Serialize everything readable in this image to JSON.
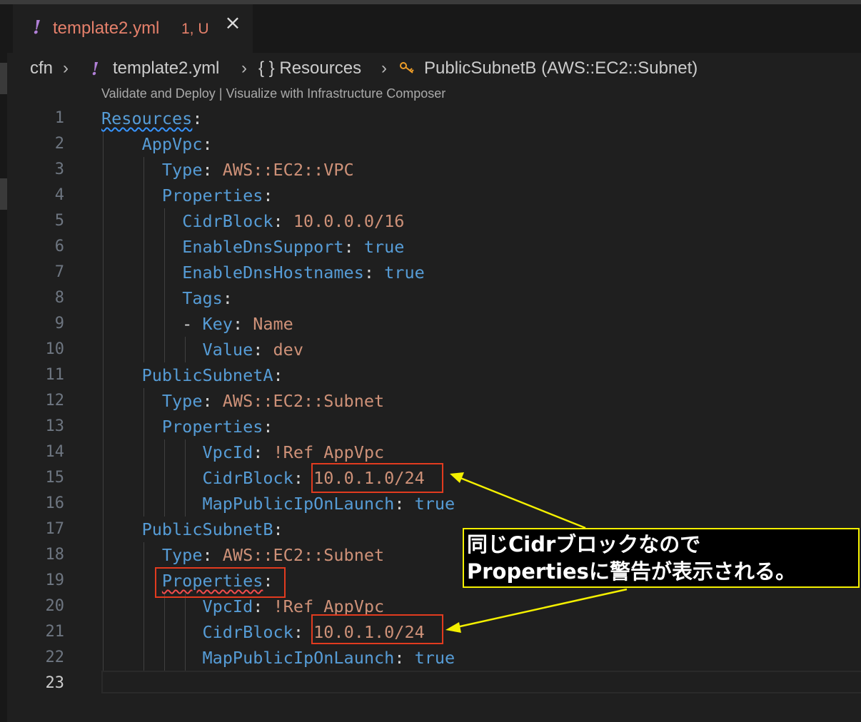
{
  "tab": {
    "icon": "yaml-icon",
    "filename": "template2.yml",
    "badge": "1, U",
    "close_icon": "close-icon"
  },
  "breadcrumb": {
    "root": "cfn",
    "file": "template2.yml",
    "section": "{ } Resources",
    "resource_icon": "symbol-key-icon",
    "resource": "PublicSubnetB (AWS::EC2::Subnet)"
  },
  "codelens": "Validate and Deploy | Visualize with Infrastructure Composer",
  "lines": [
    {
      "n": "1",
      "tokens": [
        [
          "k",
          "Resources"
        ],
        [
          "p",
          ":"
        ]
      ]
    },
    {
      "n": "2",
      "tokens": [
        [
          "p",
          "    "
        ],
        [
          "k",
          "AppVpc"
        ],
        [
          "p",
          ":"
        ]
      ]
    },
    {
      "n": "3",
      "tokens": [
        [
          "p",
          "      "
        ],
        [
          "k",
          "Type"
        ],
        [
          "p",
          ": "
        ],
        [
          "v",
          "AWS::EC2::VPC"
        ]
      ]
    },
    {
      "n": "4",
      "tokens": [
        [
          "p",
          "      "
        ],
        [
          "k",
          "Properties"
        ],
        [
          "p",
          ":"
        ]
      ]
    },
    {
      "n": "5",
      "tokens": [
        [
          "p",
          "        "
        ],
        [
          "k",
          "CidrBlock"
        ],
        [
          "p",
          ": "
        ],
        [
          "v",
          "10.0.0.0/16"
        ]
      ]
    },
    {
      "n": "6",
      "tokens": [
        [
          "p",
          "        "
        ],
        [
          "k",
          "EnableDnsSupport"
        ],
        [
          "p",
          ": "
        ],
        [
          "b",
          "true"
        ]
      ]
    },
    {
      "n": "7",
      "tokens": [
        [
          "p",
          "        "
        ],
        [
          "k",
          "EnableDnsHostnames"
        ],
        [
          "p",
          ": "
        ],
        [
          "b",
          "true"
        ]
      ]
    },
    {
      "n": "8",
      "tokens": [
        [
          "p",
          "        "
        ],
        [
          "k",
          "Tags"
        ],
        [
          "p",
          ":"
        ]
      ]
    },
    {
      "n": "9",
      "tokens": [
        [
          "p",
          "        - "
        ],
        [
          "k",
          "Key"
        ],
        [
          "p",
          ": "
        ],
        [
          "v",
          "Name"
        ]
      ]
    },
    {
      "n": "10",
      "tokens": [
        [
          "p",
          "          "
        ],
        [
          "k",
          "Value"
        ],
        [
          "p",
          ": "
        ],
        [
          "v",
          "dev"
        ]
      ]
    },
    {
      "n": "11",
      "tokens": [
        [
          "p",
          "    "
        ],
        [
          "k",
          "PublicSubnetA"
        ],
        [
          "p",
          ":"
        ]
      ]
    },
    {
      "n": "12",
      "tokens": [
        [
          "p",
          "      "
        ],
        [
          "k",
          "Type"
        ],
        [
          "p",
          ": "
        ],
        [
          "v",
          "AWS::EC2::Subnet"
        ]
      ]
    },
    {
      "n": "13",
      "tokens": [
        [
          "p",
          "      "
        ],
        [
          "k",
          "Properties"
        ],
        [
          "p",
          ":"
        ]
      ]
    },
    {
      "n": "14",
      "tokens": [
        [
          "p",
          "          "
        ],
        [
          "k",
          "VpcId"
        ],
        [
          "p",
          ": "
        ],
        [
          "v",
          "!Ref AppVpc"
        ]
      ]
    },
    {
      "n": "15",
      "tokens": [
        [
          "p",
          "          "
        ],
        [
          "k",
          "CidrBlock"
        ],
        [
          "p",
          ": "
        ],
        [
          "v",
          "10.0.1.0/24"
        ]
      ]
    },
    {
      "n": "16",
      "tokens": [
        [
          "p",
          "          "
        ],
        [
          "k",
          "MapPublicIpOnLaunch"
        ],
        [
          "p",
          ": "
        ],
        [
          "b",
          "true"
        ]
      ]
    },
    {
      "n": "17",
      "tokens": [
        [
          "p",
          "    "
        ],
        [
          "k",
          "PublicSubnetB"
        ],
        [
          "p",
          ":"
        ]
      ]
    },
    {
      "n": "18",
      "tokens": [
        [
          "p",
          "      "
        ],
        [
          "k",
          "Type"
        ],
        [
          "p",
          ": "
        ],
        [
          "v",
          "AWS::EC2::Subnet"
        ]
      ]
    },
    {
      "n": "19",
      "tokens": [
        [
          "p",
          "      "
        ],
        [
          "k",
          "Properties"
        ],
        [
          "p",
          ":"
        ]
      ]
    },
    {
      "n": "20",
      "tokens": [
        [
          "p",
          "          "
        ],
        [
          "k",
          "VpcId"
        ],
        [
          "p",
          ": "
        ],
        [
          "v",
          "!Ref AppVpc"
        ]
      ]
    },
    {
      "n": "21",
      "tokens": [
        [
          "p",
          "          "
        ],
        [
          "k",
          "CidrBlock"
        ],
        [
          "p",
          ": "
        ],
        [
          "v",
          "10.0.1.0/24"
        ]
      ]
    },
    {
      "n": "22",
      "tokens": [
        [
          "p",
          "          "
        ],
        [
          "k",
          "MapPublicIpOnLaunch"
        ],
        [
          "p",
          ": "
        ],
        [
          "b",
          "true"
        ]
      ]
    },
    {
      "n": "23",
      "tokens": []
    }
  ],
  "active_line": "23",
  "diagnostics": {
    "resources_squiggle_color": "#3794ff",
    "properties_squiggle_color": "#f14c4c"
  },
  "annotation": {
    "line1": "同じCidrブロックなので",
    "line2": "Propertiesに警告が表示される。",
    "box_color": "#e23b1f",
    "callout_border": "#f4f000",
    "arrow_color": "#f4f000"
  },
  "colors": {
    "key": "#569cd6",
    "string": "#ce9178",
    "bool": "#569cd6",
    "tab_text": "#e5806b",
    "yaml_icon": "#b180d7"
  }
}
